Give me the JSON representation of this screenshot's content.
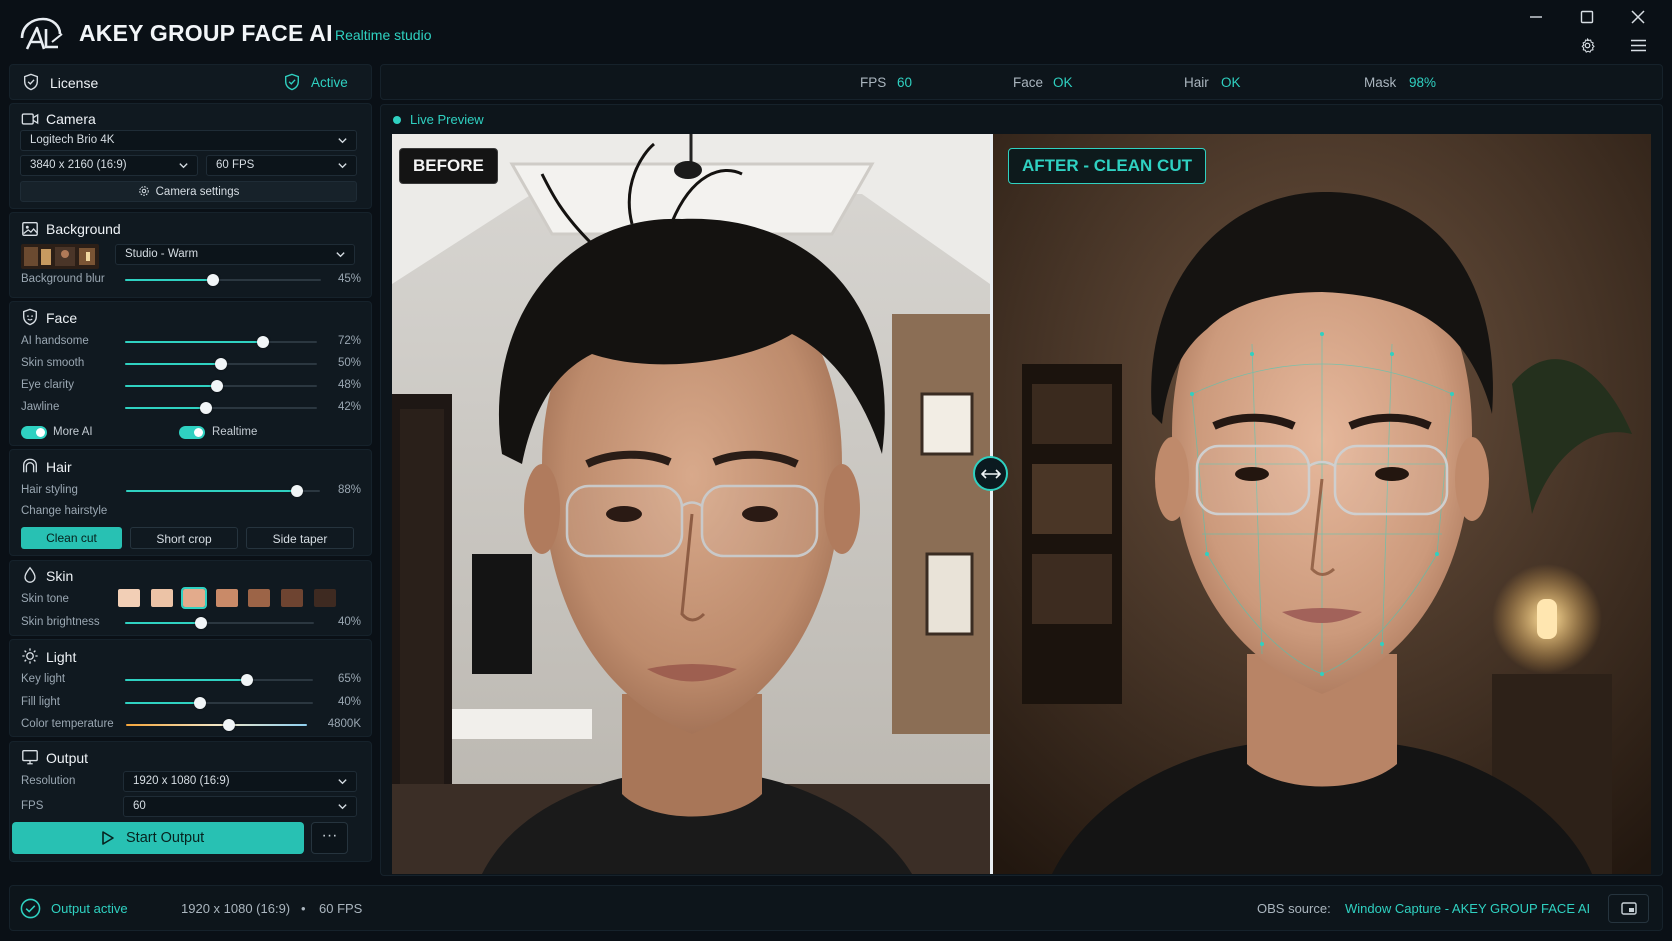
{
  "app": {
    "title": "AKEY GROUP FACE AI",
    "subtitle": "Realtime studio"
  },
  "license": {
    "label": "License",
    "status": "Active"
  },
  "camera": {
    "title": "Camera",
    "device": "Logitech Brio 4K",
    "resolution": "3840 x 2160 (16:9)",
    "fps": "60 FPS",
    "settings_label": "Camera settings"
  },
  "background": {
    "title": "Background",
    "preset": "Studio - Warm",
    "blur_label": "Background blur",
    "blur_value": "45%",
    "blur_level": 0.45
  },
  "face": {
    "title": "Face",
    "sliders": [
      {
        "label": "AI handsome",
        "value": "72%",
        "level": 0.72
      },
      {
        "label": "Skin smooth",
        "value": "50%",
        "level": 0.5
      },
      {
        "label": "Eye clarity",
        "value": "48%",
        "level": 0.48
      },
      {
        "label": "Jawline",
        "value": "42%",
        "level": 0.42
      }
    ],
    "toggle_more": "More AI",
    "toggle_realtime": "Realtime"
  },
  "hair": {
    "title": "Hair",
    "styling_label": "Hair styling",
    "styling_value": "88%",
    "styling_level": 0.88,
    "change_label": "Change hairstyle",
    "styles": [
      "Clean cut",
      "Short crop",
      "Side taper"
    ],
    "selected_style": "Clean cut"
  },
  "skin": {
    "title": "Skin",
    "tone_label": "Skin tone",
    "tones": [
      "#f2cfb6",
      "#ecc3a6",
      "#e3ab8c",
      "#c98a68",
      "#9c6447",
      "#6e4431",
      "#3e2a21"
    ],
    "selected_tone_index": 2,
    "brightness_label": "Skin brightness",
    "brightness_value": "40%",
    "brightness_level": 0.4
  },
  "light": {
    "title": "Light",
    "key_label": "Key light",
    "key_value": "65%",
    "key_level": 0.65,
    "fill_label": "Fill light",
    "fill_value": "40%",
    "fill_level": 0.4,
    "temp_label": "Color temperature",
    "temp_value": "4800K",
    "temp_level": 0.57
  },
  "output": {
    "title": "Output",
    "resolution_label": "Resolution",
    "resolution": "1920 x 1080 (16:9)",
    "fps_label": "FPS",
    "fps": "60",
    "start_label": "Start Output",
    "more_label": "···"
  },
  "stats": {
    "fps_label": "FPS",
    "fps": "60",
    "face_label": "Face",
    "face": "OK",
    "hair_label": "Hair",
    "hair": "OK",
    "mask_label": "Mask",
    "mask": "98%"
  },
  "preview": {
    "live_label": "Live Preview",
    "before_tag": "BEFORE",
    "after_tag": "AFTER - CLEAN CUT"
  },
  "footer": {
    "status": "Output active",
    "resolution": "1920 x 1080 (16:9)",
    "sep": "•",
    "fps": "60 FPS",
    "obs_label": "OBS source:",
    "obs_value": "Window Capture - AKEY GROUP FACE AI"
  },
  "colors": {
    "accent": "#2fd1c1",
    "bg": "#0a1016",
    "panel": "#101920"
  }
}
